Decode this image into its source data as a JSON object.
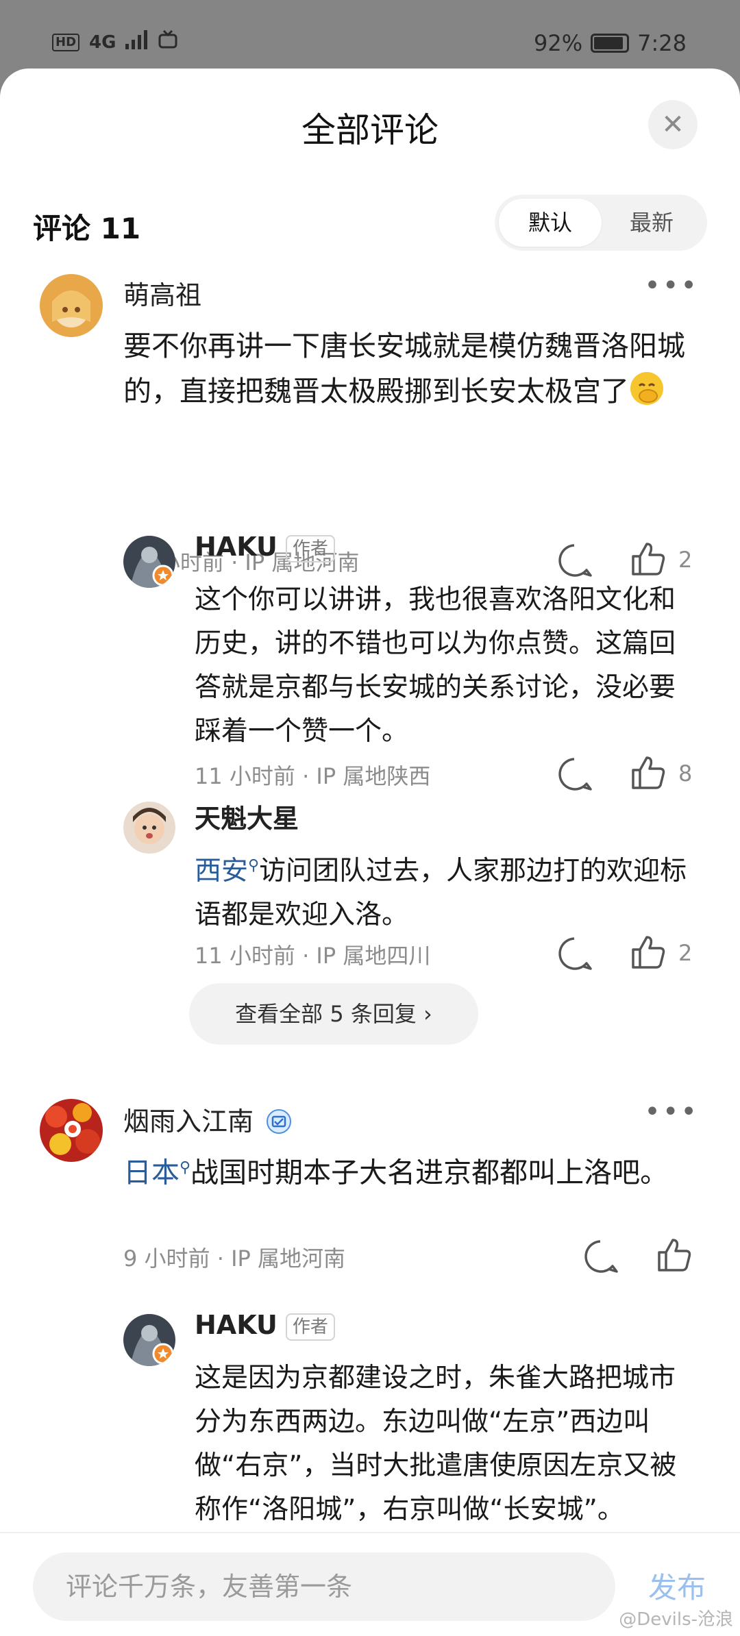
{
  "status_bar": {
    "hd": "HD",
    "network": "4G",
    "battery": "92%",
    "battery_level": 0.92,
    "time": "7:28"
  },
  "sheet": {
    "title": "全部评论",
    "comment_count_label": "评论 11",
    "sort": {
      "default": "默认",
      "latest": "最新",
      "selected": "默认"
    }
  },
  "comments": [
    {
      "user": "萌高祖",
      "text_main": "要不你再讲一下唐长安城就是模仿魏晋洛阳城的，直接把魏晋太极殿挪到长安太极宫了",
      "emoji": "face-with-hand-over-mouth-emoji",
      "time": "12 小时前",
      "ip": "IP 属地河南",
      "likes": "2",
      "replies": [
        {
          "user": "HAKU",
          "badge": "作者",
          "text": "这个你可以讲讲，我也很喜欢洛阳文化和历史，讲的不错也可以为你点赞。这篇回答就是京都与长安城的关系讨论，没必要踩着一个赞一个。",
          "time": "11 小时前",
          "ip": "IP 属地陕西",
          "likes": "8"
        },
        {
          "user": "天魁大星",
          "link": "西安",
          "text": "访问团队过去，人家那边打的欢迎标语都是欢迎入洛。",
          "time": "11 小时前",
          "ip": "IP 属地四川",
          "likes": "2"
        }
      ],
      "view_all": "查看全部 5 条回复"
    },
    {
      "user": "烟雨入江南",
      "link": "日本",
      "text": "战国时期本子大名进京都都叫上洛吧。",
      "time": "9 小时前",
      "ip": "IP 属地河南",
      "likes": "",
      "replies": [
        {
          "user": "HAKU",
          "badge": "作者",
          "text": "这是因为京都建设之时，朱雀大路把城市分为东西两边。东边叫做“左京”西边叫做“右京”，当时大批遣唐使原因左京又被称作“洛阳城”，右京叫做“长安城”。"
        }
      ]
    }
  ],
  "meta_separator": " · ",
  "input": {
    "placeholder": "评论千万条，友善第一条"
  },
  "publish_label": "发布",
  "watermark": "@Devils-沧浪",
  "colors": {
    "link": "#2b5c9a",
    "publish": "#9cc0ee",
    "meta": "#8c8c8c"
  }
}
